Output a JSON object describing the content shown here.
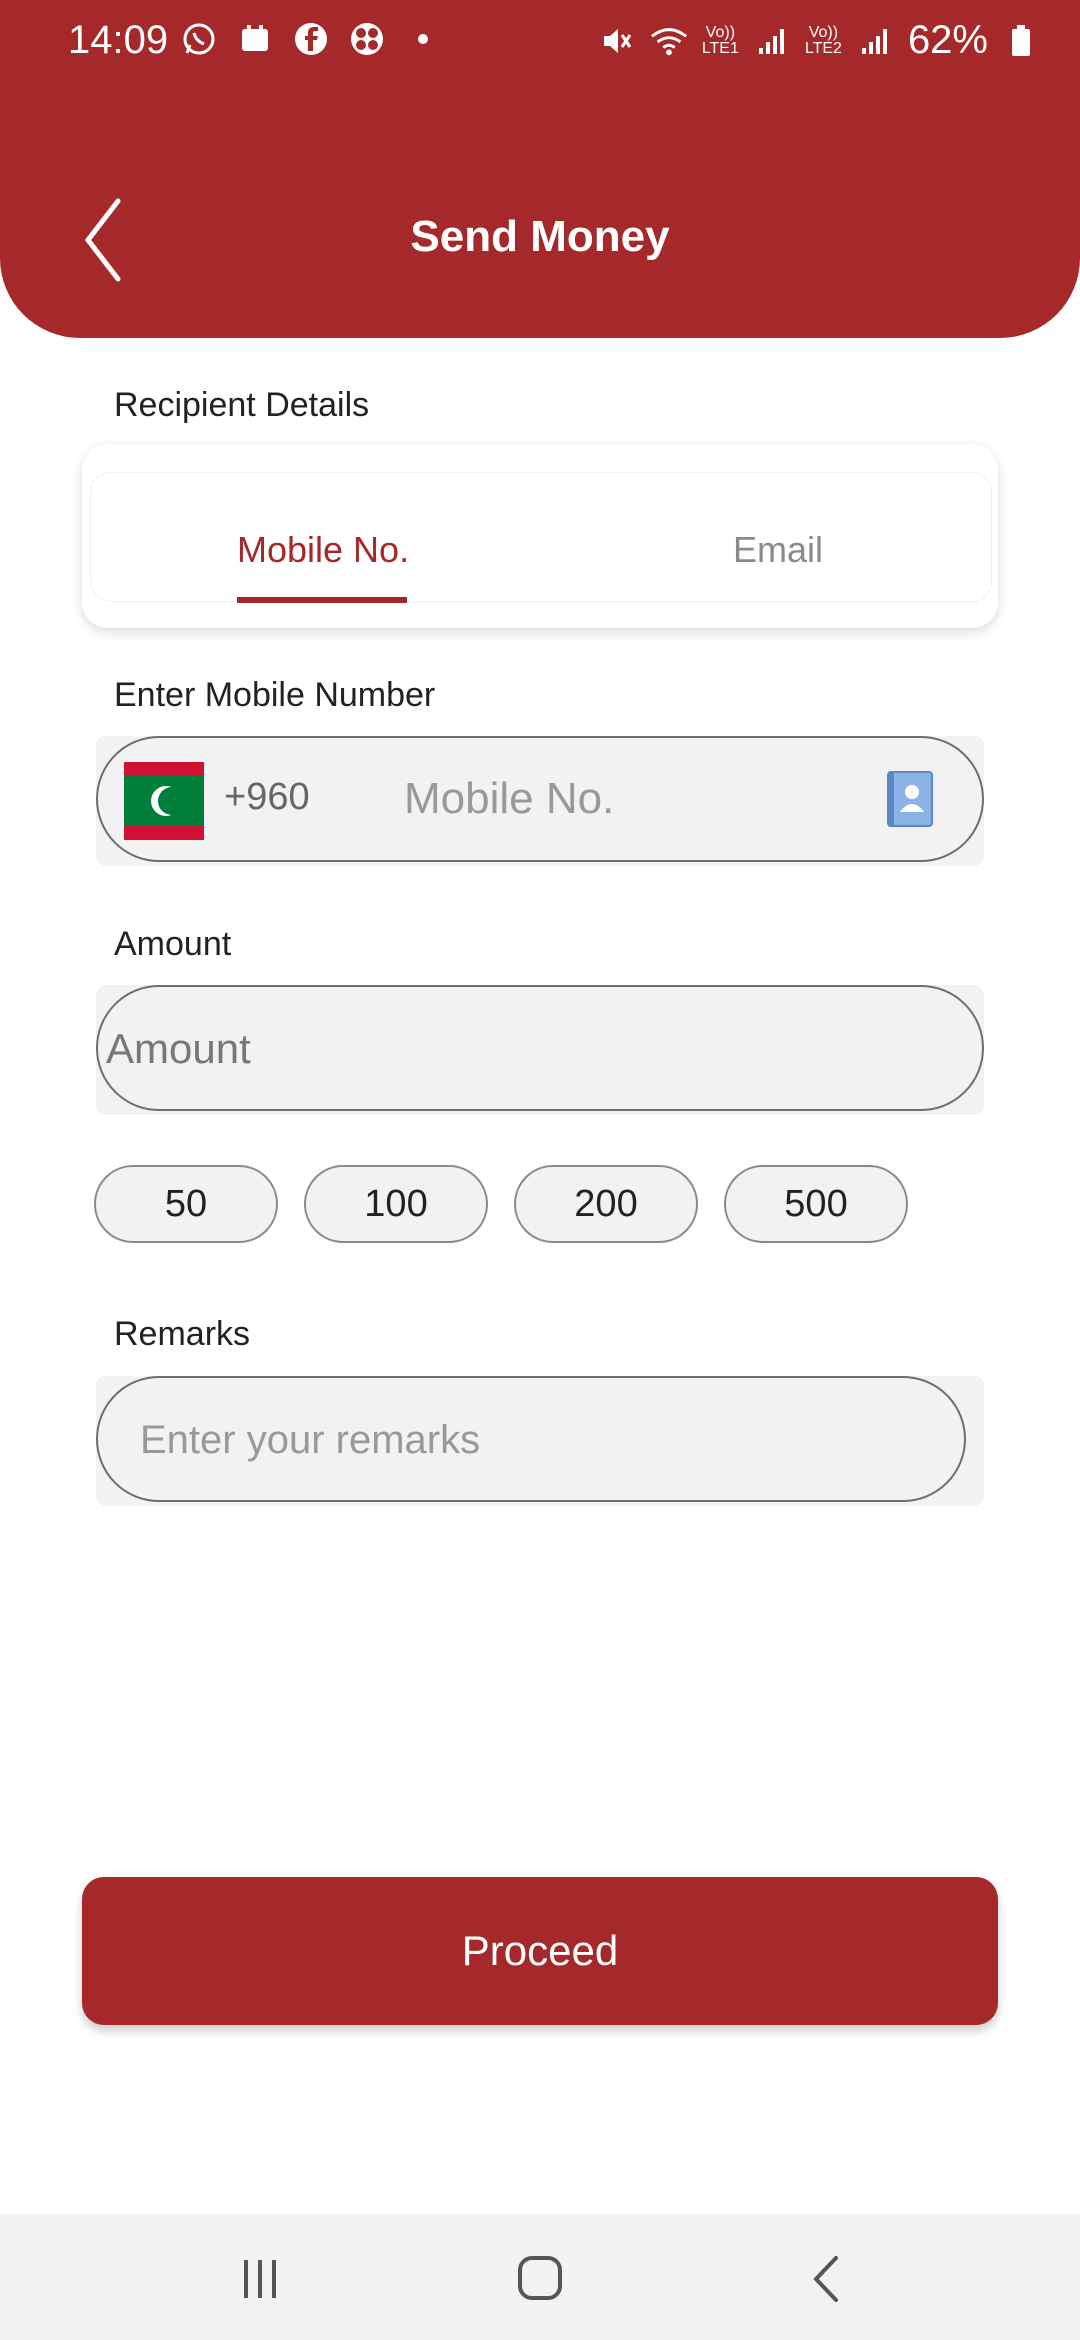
{
  "status_bar": {
    "time": "14:09",
    "battery": "62%",
    "lte1": "LTE1",
    "lte2": "LTE2",
    "volte": "Vo))"
  },
  "header": {
    "title": "Send Money"
  },
  "recipient": {
    "section_label": "Recipient Details",
    "tabs": [
      {
        "label": "Mobile No.",
        "active": true
      },
      {
        "label": "Email",
        "active": false
      }
    ]
  },
  "mobile": {
    "label": "Enter Mobile Number",
    "country_code": "+960",
    "placeholder": "Mobile No."
  },
  "amount": {
    "label": "Amount",
    "placeholder": "Amount",
    "quick_amounts": [
      "50",
      "100",
      "200",
      "500"
    ]
  },
  "remarks": {
    "label": "Remarks",
    "placeholder": "Enter your remarks"
  },
  "proceed": {
    "label": "Proceed"
  },
  "colors": {
    "brand": "#a5292b",
    "field_bg": "#f2f2f2"
  }
}
